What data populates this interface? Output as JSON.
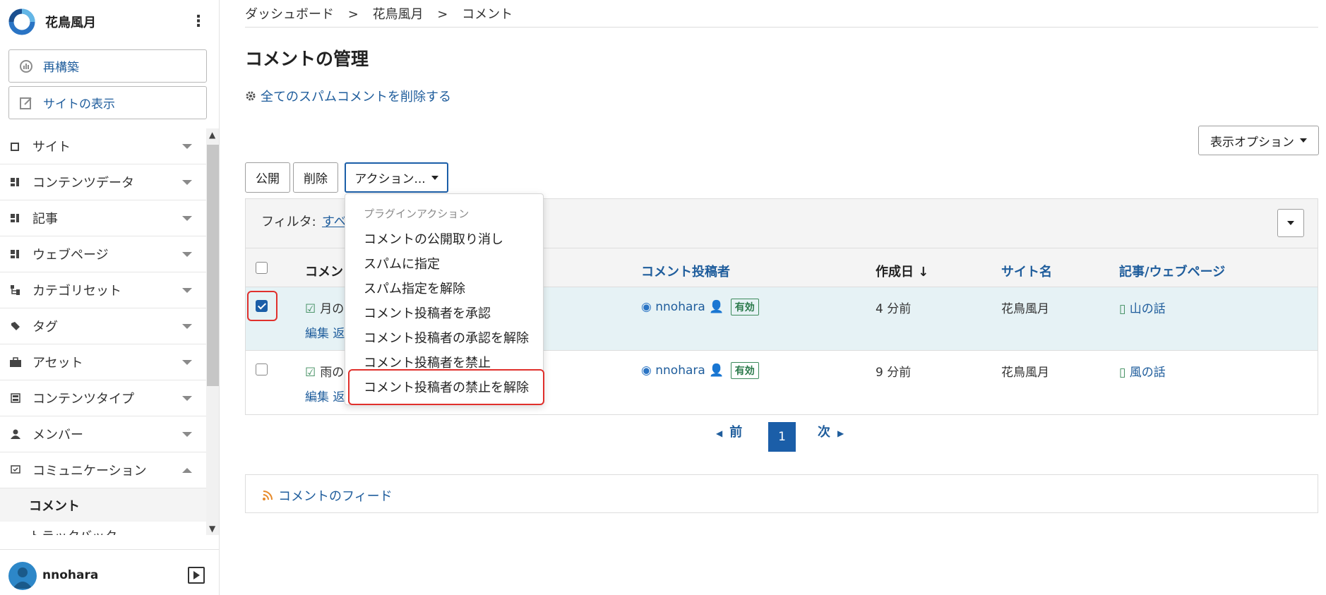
{
  "sidebar": {
    "site_name": "花鳥風月",
    "rebuild_label": "再構築",
    "view_site_label": "サイトの表示",
    "items": [
      {
        "label": "サイト",
        "icon": "site-icon"
      },
      {
        "label": "コンテンツデータ",
        "icon": "content-data-icon"
      },
      {
        "label": "記事",
        "icon": "entry-icon"
      },
      {
        "label": "ウェブページ",
        "icon": "page-icon"
      },
      {
        "label": "カテゴリセット",
        "icon": "category-set-icon"
      },
      {
        "label": "タグ",
        "icon": "tag-icon"
      },
      {
        "label": "アセット",
        "icon": "asset-icon"
      },
      {
        "label": "コンテンツタイプ",
        "icon": "content-type-icon"
      },
      {
        "label": "メンバー",
        "icon": "member-icon"
      },
      {
        "label": "コミュニケーション",
        "icon": "communication-icon"
      }
    ],
    "sub_active": "コメント",
    "sub_next": "トラックバック",
    "user": "nnohara"
  },
  "breadcrumb": [
    "ダッシュボード",
    ">",
    "花鳥風月",
    ">",
    "コメント"
  ],
  "page_title": "コメントの管理",
  "delete_spam_link": "全てのスパムコメントを削除する",
  "display_options_label": "表示オプション",
  "toolbar": {
    "publish": "公開",
    "delete": "削除",
    "actions": "アクション..."
  },
  "filter": {
    "label": "フィルタ:",
    "value": "すべ"
  },
  "columns": {
    "comment": "コメン",
    "commenter": "コメント投稿者",
    "created": "作成日 ↓",
    "site": "サイト名",
    "entry": "記事/ウェブページ"
  },
  "rows": [
    {
      "checked": true,
      "comment": "月の",
      "actions": "編集 返",
      "commenter": "nnohara",
      "status": "有効",
      "created": "4 分前",
      "site": "花鳥風月",
      "entry": "山の話"
    },
    {
      "checked": false,
      "comment": "雨の",
      "actions": "編集 返",
      "commenter": "nnohara",
      "status": "有効",
      "created": "9 分前",
      "site": "花鳥風月",
      "entry": "風の話"
    }
  ],
  "action_menu": {
    "header": "プラグインアクション",
    "items": [
      "コメントの公開取り消し",
      "スパムに指定",
      "スパム指定を解除",
      "コメント投稿者を承認",
      "コメント投稿者の承認を解除",
      "コメント投稿者を禁止",
      "コメント投稿者の禁止を解除"
    ]
  },
  "pagination": {
    "prev": "前",
    "current": "1",
    "next": "次"
  },
  "feed_label": "コメントのフィード",
  "colors": {
    "link": "#1f5d9c",
    "primary": "#1b5ea8",
    "highlight": "#e0302c",
    "selected_row": "#e6f2f5"
  }
}
